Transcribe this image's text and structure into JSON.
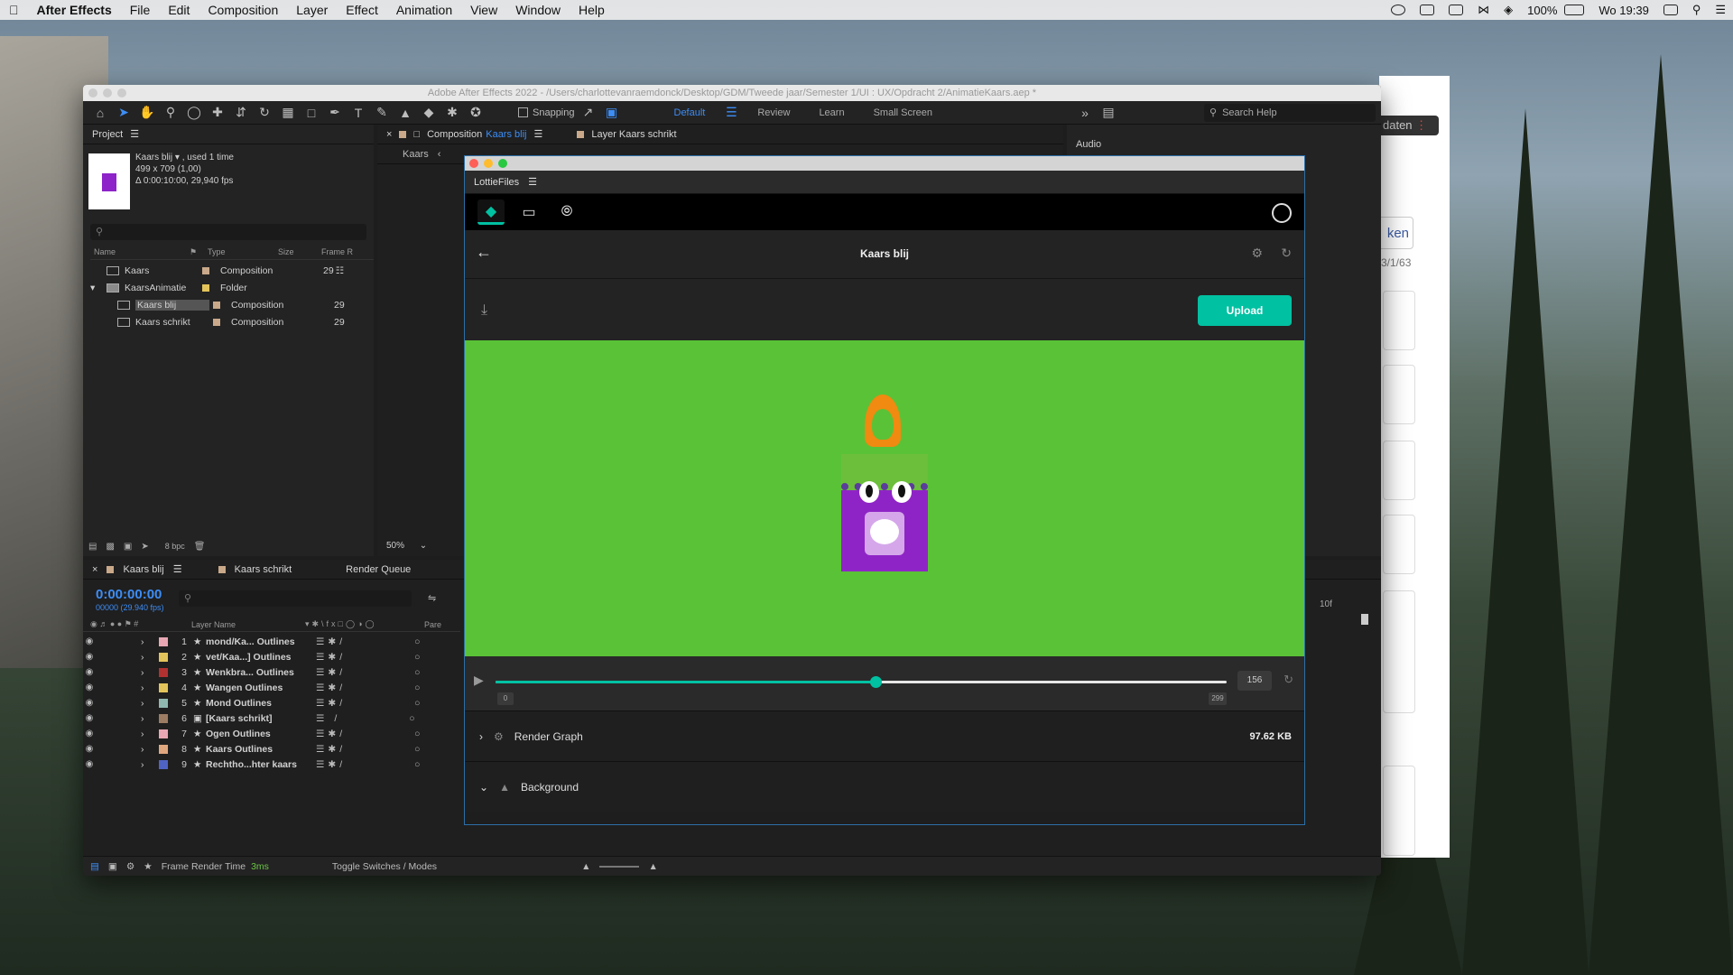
{
  "menubar": {
    "app": "After Effects",
    "items": [
      "File",
      "Edit",
      "Composition",
      "Layer",
      "Effect",
      "Animation",
      "View",
      "Window",
      "Help"
    ],
    "battery": "100%",
    "clock": "Wo 19:39"
  },
  "window": {
    "title": "Adobe After Effects 2022 - /Users/charlottevanraemdonck/Desktop/GDM/Tweede jaar/Semester 1/UI : UX/Opdracht 2/AnimatieKaars.aep *"
  },
  "toolbar": {
    "snapping": "Snapping",
    "workspaces": [
      "Default",
      "Review",
      "Learn",
      "Small Screen"
    ],
    "search_placeholder": "Search Help"
  },
  "project": {
    "title": "Project",
    "selected_name": "Kaars blij",
    "used": ", used 1 time",
    "dims": "499 x 709 (1,00)",
    "duration": "Δ 0:00:10:00, 29,940 fps",
    "columns": [
      "Name",
      "Type",
      "Size",
      "Frame R"
    ],
    "rows": [
      {
        "name": "Kaars",
        "type": "Composition",
        "frames": "29",
        "color": "#c9a98a"
      },
      {
        "name": "KaarsAnimatie",
        "type": "Folder",
        "frames": "",
        "color": "#e3c45b"
      },
      {
        "name": "Kaars blij",
        "type": "Composition",
        "frames": "29",
        "color": "#c9a98a"
      },
      {
        "name": "Kaars schrikt",
        "type": "Composition",
        "frames": "29",
        "color": "#c9a98a"
      }
    ],
    "bpc": "8 bpc"
  },
  "comp": {
    "tab": "Composition",
    "tab_name": "Kaars blij",
    "layer_tab": "Layer Kaars schrikt",
    "breadcrumb": "Kaars",
    "zoom": "50%"
  },
  "right_panel": {
    "audio": "Audio"
  },
  "timeline": {
    "tabs": [
      "Kaars blij",
      "Kaars schrikt",
      "Render Queue"
    ],
    "timecode": "0:00:00:00",
    "fps": "00000 (29.940 fps)",
    "col_layer": "Layer Name",
    "col_parent": "Pare",
    "ruler": "10f",
    "layers": [
      {
        "num": "1",
        "name": "mond/Ka... Outlines",
        "color": "#e8a7b3"
      },
      {
        "num": "2",
        "name": "vet/Kaa...] Outlines",
        "color": "#e3c45b"
      },
      {
        "num": "3",
        "name": "Wenkbra... Outlines",
        "color": "#b13131"
      },
      {
        "num": "4",
        "name": "Wangen Outlines",
        "color": "#e3c45b"
      },
      {
        "num": "5",
        "name": "Mond Outlines",
        "color": "#8fb7b0"
      },
      {
        "num": "6",
        "name": "[Kaars schrikt]",
        "color": "#9c7c63"
      },
      {
        "num": "7",
        "name": "Ogen Outlines",
        "color": "#e8a7b3"
      },
      {
        "num": "8",
        "name": "Kaars Outlines",
        "color": "#e0a77f"
      },
      {
        "num": "9",
        "name": "Rechtho...hter kaars",
        "color": "#4f63c4"
      }
    ]
  },
  "status": {
    "render_label": "Frame Render Time",
    "render_value": "3ms",
    "toggle": "Toggle Switches / Modes"
  },
  "lottie": {
    "panel_title": "LottieFiles",
    "anim_title": "Kaars blij",
    "upload": "Upload",
    "frame": "156",
    "min": "0",
    "max": "299",
    "progress": 0.52,
    "render_graph": "Render Graph",
    "size": "97.62 KB",
    "background": "Background",
    "accent": "#00c1a2",
    "canvas_bg": "#5ac236"
  },
  "browser": {
    "button": "ken",
    "date": "3/1/63",
    "pill": "daten"
  }
}
